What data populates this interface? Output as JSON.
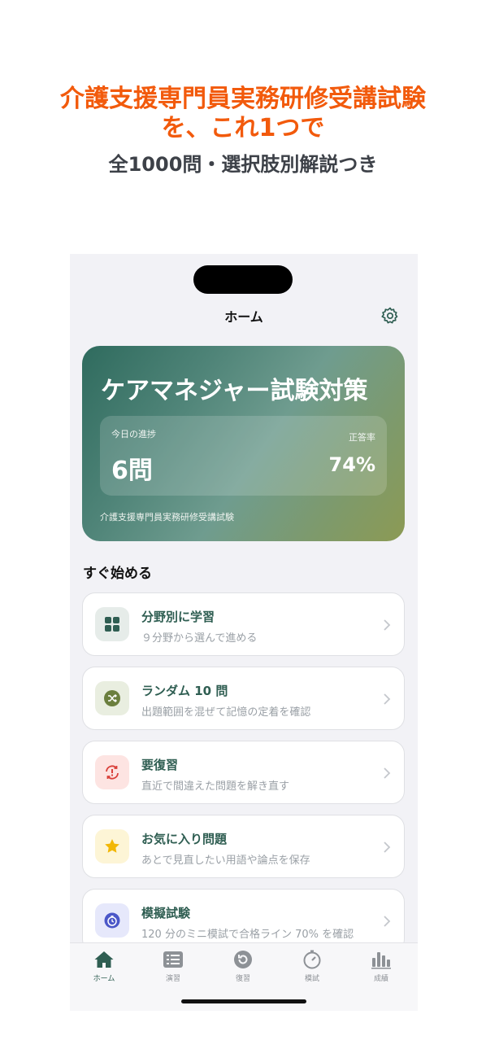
{
  "promo": {
    "title_line1": "介護支援専門員実務研修受講試験",
    "title_line2": "を、これ1つで",
    "subtitle": "全1000問・選択肢別解説つき"
  },
  "nav": {
    "title": "ホーム",
    "settings_icon": "gear-icon"
  },
  "hero": {
    "title": "ケアマネジャー試験対策",
    "progress_label": "今日の進捗",
    "progress_value": "6問",
    "accuracy_label": "正答率",
    "accuracy_value": "74%",
    "footer": "介護支援専門員実務研修受講試験"
  },
  "section": {
    "title": "すぐ始める"
  },
  "menu": [
    {
      "title": "分野別に学習",
      "desc": "９分野から選んで進める",
      "icon": "grid-icon",
      "icon_color": "#2f5e52",
      "bg_color": "#e6ece9"
    },
    {
      "title": "ランダム 10 問",
      "desc": "出題範囲を混ぜて記憶の定着を確認",
      "icon": "shuffle-icon",
      "icon_color": "#6b7f3e",
      "bg_color": "#e9eee0"
    },
    {
      "title": "要復習",
      "desc": "直近で間違えた問題を解き直す",
      "icon": "review-alert-icon",
      "icon_color": "#d9403a",
      "bg_color": "#fde4e2"
    },
    {
      "title": "お気に入り問題",
      "desc": "あとで見直したい用語や論点を保存",
      "icon": "star-icon",
      "icon_color": "#f2b705",
      "bg_color": "#fdf5d6"
    },
    {
      "title": "模擬試験",
      "desc": "120 分のミニ模試で合格ライン 70% を確認",
      "icon": "timer-icon",
      "icon_color": "#4b57c8",
      "bg_color": "#e6e8fb"
    }
  ],
  "tabs": [
    {
      "label": "ホーム",
      "icon": "home-icon",
      "active": true
    },
    {
      "label": "演習",
      "icon": "list-icon",
      "active": false
    },
    {
      "label": "復習",
      "icon": "replay-icon",
      "active": false
    },
    {
      "label": "模試",
      "icon": "stopwatch-icon",
      "active": false
    },
    {
      "label": "成績",
      "icon": "bar-chart-icon",
      "active": false
    }
  ]
}
